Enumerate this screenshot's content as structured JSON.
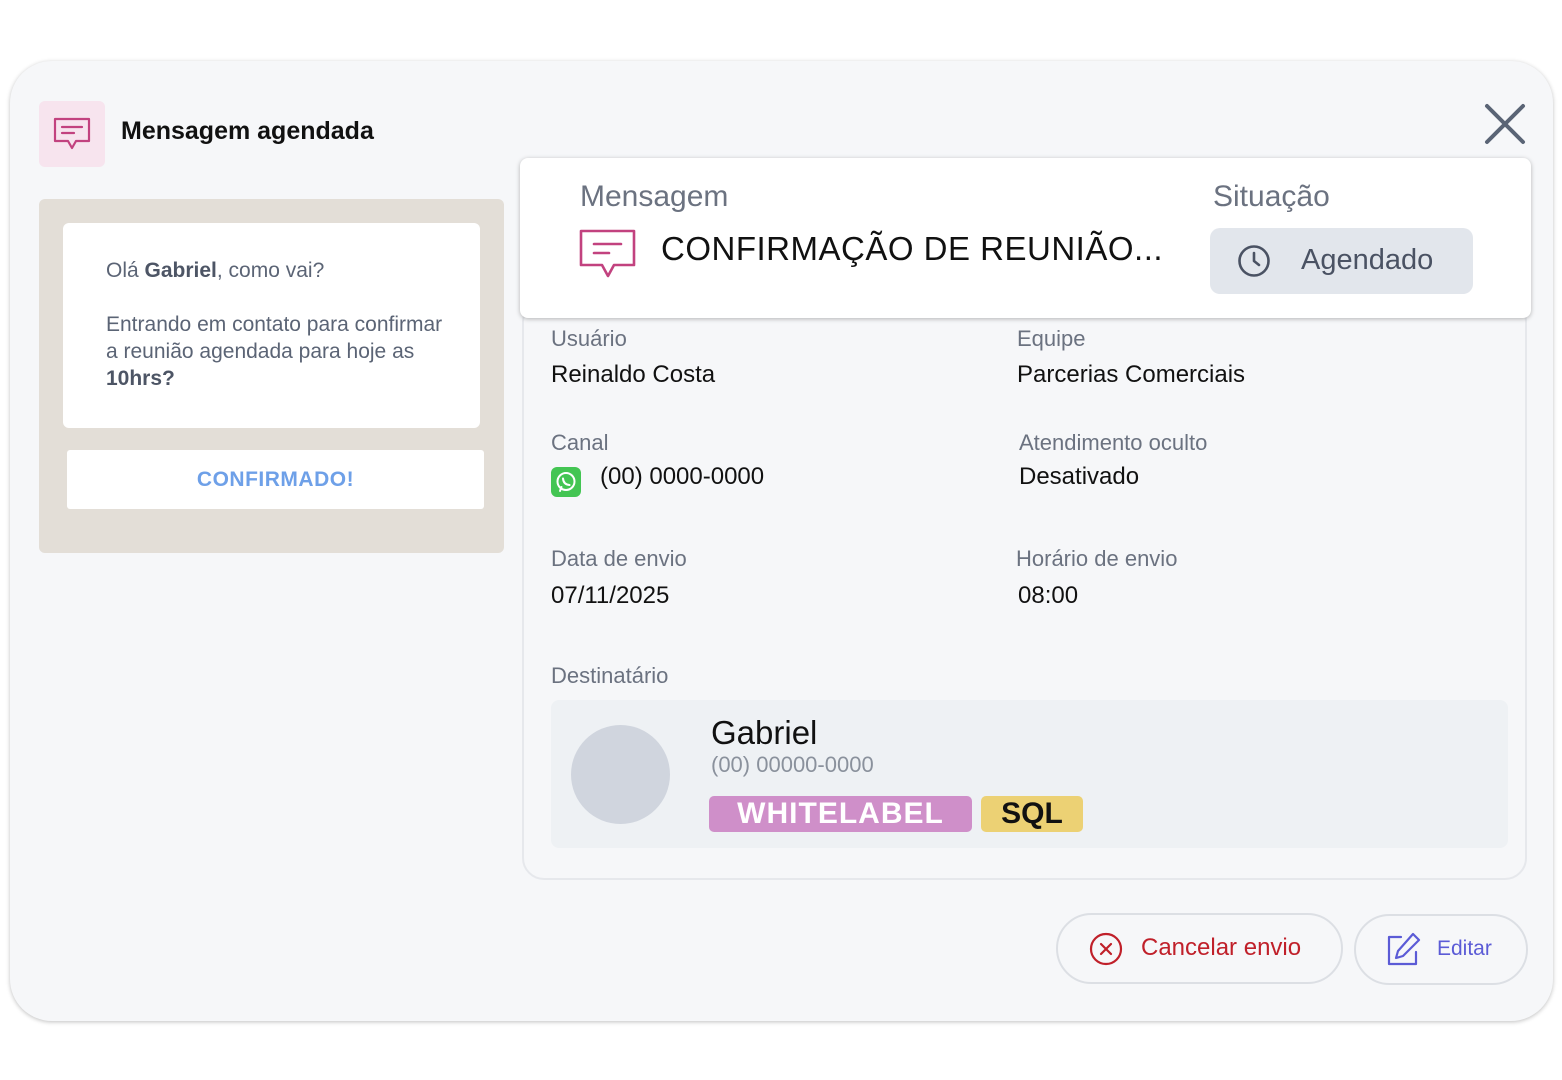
{
  "header": {
    "title": "Mensagem agendada"
  },
  "preview": {
    "greeting_prefix": "Olá ",
    "greeting_name": "Gabriel",
    "greeting_suffix": ", como vai?",
    "body_prefix": "Entrando em contato para confirmar a reunião agendada para hoje as ",
    "body_bold": "10hrs?",
    "button_label": "CONFIRMADO!"
  },
  "summary": {
    "message_label": "Mensagem",
    "message_title": "CONFIRMAÇÃO DE REUNIÃO...",
    "status_label": "Situação",
    "status_value": "Agendado"
  },
  "fields": {
    "user_label": "Usuário",
    "user_value": "Reinaldo Costa",
    "team_label": "Equipe",
    "team_value": "Parcerias Comerciais",
    "channel_label": "Canal",
    "channel_value": "(00) 0000-0000",
    "hidden_label": "Atendimento oculto",
    "hidden_value": "Desativado",
    "date_label": "Data de envio",
    "date_value": "07/11/2025",
    "time_label": "Horário de envio",
    "time_value": "08:00"
  },
  "recipient": {
    "label": "Destinatário",
    "name": "Gabriel",
    "phone": "(00) 00000-0000",
    "tags": [
      "WHITELABEL",
      "SQL"
    ]
  },
  "actions": {
    "cancel_label": "Cancelar envio",
    "edit_label": "Editar"
  },
  "colors": {
    "accent_pink": "#c2427f",
    "cancel_red": "#c0202a",
    "edit_blue": "#5b5bd6",
    "whatsapp_green": "#43c553",
    "tag_whitelabel": "#cf8fc9",
    "tag_sql": "#ecd174"
  }
}
